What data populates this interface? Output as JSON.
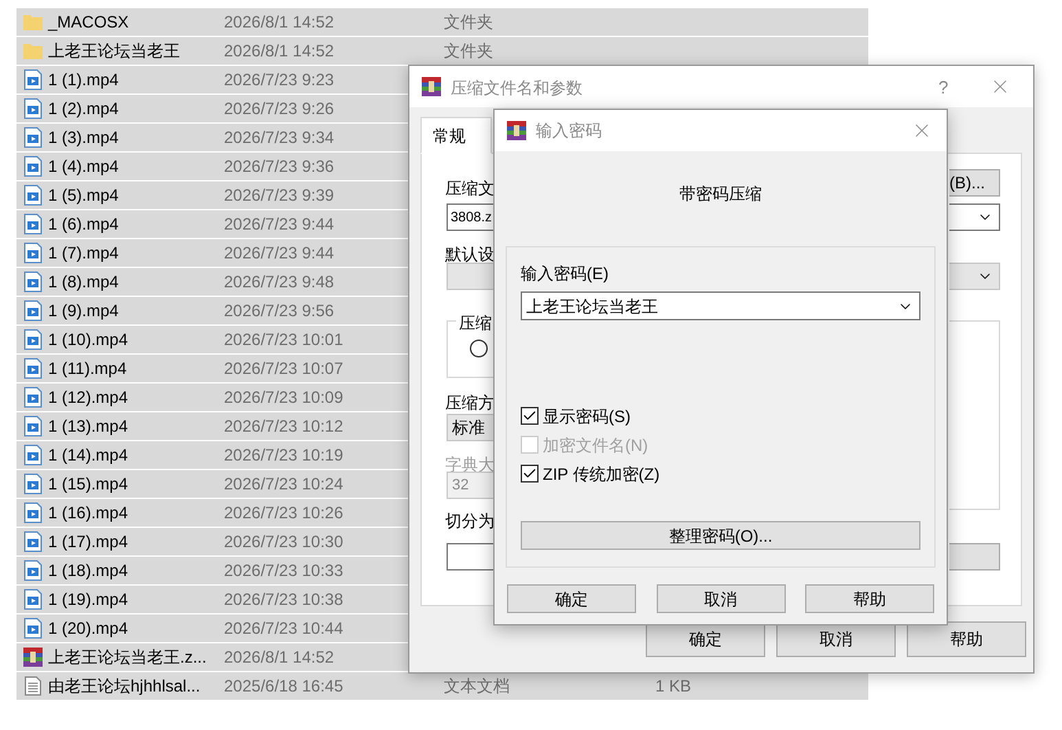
{
  "file_list": {
    "rows": [
      {
        "kind": "folder",
        "name": "_MACOSX",
        "date": "2026/8/1 14:52",
        "type": "文件夹",
        "selected": true
      },
      {
        "kind": "folder",
        "name": "上老王论坛当老王",
        "date": "2026/8/1 14:52",
        "type": "文件夹",
        "selected": true
      },
      {
        "kind": "video",
        "name": "1 (1).mp4",
        "date": "2026/7/23 9:23",
        "selected": true
      },
      {
        "kind": "video",
        "name": "1 (2).mp4",
        "date": "2026/7/23 9:26",
        "selected": true
      },
      {
        "kind": "video",
        "name": "1 (3).mp4",
        "date": "2026/7/23 9:34",
        "selected": true
      },
      {
        "kind": "video",
        "name": "1 (4).mp4",
        "date": "2026/7/23 9:36",
        "selected": true
      },
      {
        "kind": "video",
        "name": "1 (5).mp4",
        "date": "2026/7/23 9:39",
        "selected": true
      },
      {
        "kind": "video",
        "name": "1 (6).mp4",
        "date": "2026/7/23 9:44",
        "selected": true
      },
      {
        "kind": "video",
        "name": "1 (7).mp4",
        "date": "2026/7/23 9:44",
        "selected": true
      },
      {
        "kind": "video",
        "name": "1 (8).mp4",
        "date": "2026/7/23 9:48",
        "selected": true
      },
      {
        "kind": "video",
        "name": "1 (9).mp4",
        "date": "2026/7/23 9:56",
        "selected": true
      },
      {
        "kind": "video",
        "name": "1 (10).mp4",
        "date": "2026/7/23 10:01",
        "selected": true
      },
      {
        "kind": "video",
        "name": "1 (11).mp4",
        "date": "2026/7/23 10:07",
        "selected": true
      },
      {
        "kind": "video",
        "name": "1 (12).mp4",
        "date": "2026/7/23 10:09",
        "selected": true
      },
      {
        "kind": "video",
        "name": "1 (13).mp4",
        "date": "2026/7/23 10:12",
        "selected": true
      },
      {
        "kind": "video",
        "name": "1 (14).mp4",
        "date": "2026/7/23 10:19",
        "selected": true
      },
      {
        "kind": "video",
        "name": "1 (15).mp4",
        "date": "2026/7/23 10:24",
        "selected": true
      },
      {
        "kind": "video",
        "name": "1 (16).mp4",
        "date": "2026/7/23 10:26",
        "selected": true
      },
      {
        "kind": "video",
        "name": "1 (17).mp4",
        "date": "2026/7/23 10:30",
        "selected": true
      },
      {
        "kind": "video",
        "name": "1 (18).mp4",
        "date": "2026/7/23 10:33",
        "selected": true
      },
      {
        "kind": "video",
        "name": "1 (19).mp4",
        "date": "2026/7/23 10:38",
        "selected": true
      },
      {
        "kind": "video",
        "name": "1 (20).mp4",
        "date": "2026/7/23 10:44",
        "selected": true
      },
      {
        "kind": "archive",
        "name": "上老王论坛当老王.z...",
        "date": "2026/8/1 14:52",
        "selected": true
      },
      {
        "kind": "text",
        "name": "由老王论坛hjhhlsal...",
        "date": "2025/6/18 16:45",
        "type": "文本文档",
        "size": "1 KB",
        "selected": true
      }
    ]
  },
  "archive_dialog": {
    "title": "压缩文件名和参数",
    "help": "?",
    "tabs": [
      {
        "label": "常规",
        "selected": true
      }
    ],
    "archive_name_label": "压缩文",
    "archive_name_value": "3808.z",
    "browse_button": "(B)...",
    "default_profile_label": "默认设",
    "format_group_label": "压缩",
    "format_radio": {
      "selected": false
    },
    "method_label": "压缩方",
    "method_value": "标准",
    "dictionary": {
      "label": "字典大",
      "value": "32",
      "disabled": true
    },
    "split_label": "切分为",
    "buttons": [
      "确定",
      "取消",
      "帮助"
    ]
  },
  "password_dialog": {
    "title": "输入密码",
    "heading": "带密码压缩",
    "password_label": "输入密码(E)",
    "password_value": "上老王论坛当老王",
    "options": [
      {
        "label": "显示密码(S)",
        "checked": true,
        "disabled": false
      },
      {
        "label": "加密文件名(N)",
        "checked": false,
        "disabled": true
      },
      {
        "label": "ZIP 传统加密(Z)",
        "checked": true,
        "disabled": false
      }
    ],
    "manage_button": "整理密码(O)...",
    "buttons": [
      "确定",
      "取消",
      "帮助"
    ]
  }
}
